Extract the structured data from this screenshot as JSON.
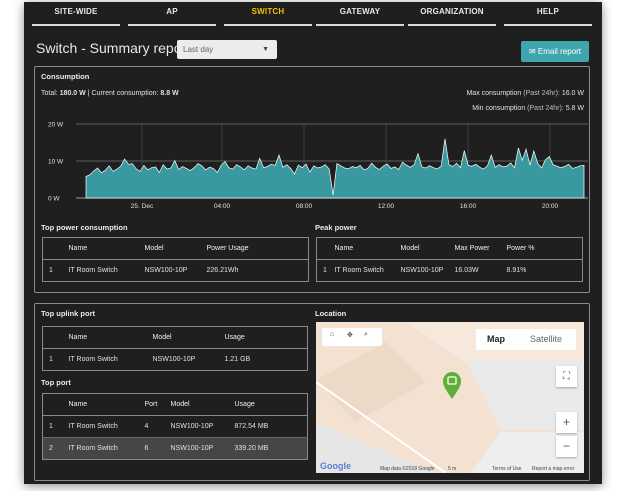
{
  "nav": [
    {
      "label": "SITE-WIDE",
      "active": false
    },
    {
      "label": "AP",
      "active": false
    },
    {
      "label": "SWITCH",
      "active": true
    },
    {
      "label": "GATEWAY",
      "active": false
    },
    {
      "label": "ORGANIZATION",
      "active": false
    },
    {
      "label": "HELP",
      "active": false
    }
  ],
  "header": {
    "title": "Switch - Summary report",
    "period": "Last day",
    "email_label": "Email report"
  },
  "consumption": {
    "title": "Consumption",
    "total_label": "Total:",
    "total": "180.0 W",
    "sep": "|",
    "current_label": "Current consumption:",
    "current": "8.8 W",
    "max_label": "Max consumption",
    "max_range": "(Past 24hr):",
    "max": "16.0 W",
    "min_label": "Min consumption",
    "min_range": "(Past 24hr):",
    "min": "5.8 W"
  },
  "chart_data": {
    "type": "area",
    "yticks": [
      "20 W",
      "10 W",
      "0 W"
    ],
    "ylim": [
      0,
      20
    ],
    "xticks": [
      "25. Dec",
      "04:00",
      "08:00",
      "12:00",
      "16:00",
      "20:00"
    ],
    "color": "#3a98a0",
    "values": [
      5.8,
      6.3,
      7.3,
      8.1,
      6.8,
      7.5,
      8.7,
      7.2,
      7.8,
      8.6,
      10.5,
      9.1,
      9.3,
      7.9,
      7.2,
      8.8,
      7.6,
      8.2,
      8.4,
      6.9,
      9.0,
      7.8,
      8.1,
      10.1,
      7.7,
      8.5,
      8.0,
      7.4,
      8.2,
      9.3,
      8.7,
      7.6,
      8.3,
      8.0,
      6.9,
      8.8,
      9.9,
      8.2,
      7.8,
      9.0,
      8.4,
      7.6,
      8.7,
      8.1,
      7.8,
      10.7,
      8.2,
      8.5,
      9.1,
      8.8,
      11.6,
      8.3,
      9.0,
      8.0,
      6.5,
      8.9,
      8.2,
      9.2,
      7.0,
      8.7,
      8.1,
      8.4,
      9.0,
      7.8,
      0.8,
      9.3,
      8.7,
      8.1,
      7.9,
      8.5,
      8.2,
      8.8,
      7.6,
      8.0,
      9.4,
      8.3,
      7.7,
      8.6,
      9.2,
      8.0,
      8.4,
      7.7,
      9.7,
      8.9,
      8.3,
      9.0,
      12.0,
      8.4,
      8.1,
      8.7,
      8.2,
      7.9,
      8.6,
      16.0,
      9.0,
      8.5,
      9.4,
      8.2,
      12.8,
      8.8,
      8.6,
      9.1,
      8.3,
      7.8,
      8.7,
      11.6,
      8.3,
      9.0,
      8.4,
      8.6,
      9.5,
      8.2,
      13.5,
      10.2,
      13.2,
      8.9,
      12.7,
      9.4,
      8.1,
      10.3,
      11.2,
      9.0,
      8.6,
      8.2,
      8.5,
      9.1,
      8.0,
      8.3,
      8.7,
      8.8
    ],
    "dip_index": 64
  },
  "top_power": {
    "title": "Top power consumption",
    "headers": [
      "Name",
      "Model",
      "Power Usage"
    ],
    "rows": [
      {
        "rank": "1",
        "name": "IT Room Switch",
        "model": "NSW100-10P",
        "usage": "226.21Wh"
      }
    ]
  },
  "peak_power": {
    "title": "Peak power",
    "headers": [
      "Name",
      "Model",
      "Max Power",
      "Power %"
    ],
    "rows": [
      {
        "rank": "1",
        "name": "IT Room Switch",
        "model": "NSW100-10P",
        "max": "16.03W",
        "pct": "8.91%"
      }
    ]
  },
  "top_uplink": {
    "title": "Top uplink port",
    "headers": [
      "Name",
      "Model",
      "Usage"
    ],
    "rows": [
      {
        "rank": "1",
        "name": "IT Room Switch",
        "model": "NSW100-10P",
        "usage": "1.21 GB"
      }
    ]
  },
  "top_port": {
    "title": "Top port",
    "headers": [
      "Name",
      "Port",
      "Model",
      "Usage"
    ],
    "rows": [
      {
        "rank": "1",
        "name": "IT Room Switch",
        "port": "4",
        "model": "NSW100-10P",
        "usage": "872.54 MB"
      },
      {
        "rank": "2",
        "name": "IT Room Switch",
        "port": "6",
        "model": "NSW100-10P",
        "usage": "339.20 MB"
      }
    ]
  },
  "location": {
    "title": "Location",
    "map_label": "Map",
    "satellite_label": "Satellite",
    "zoom_in": "+",
    "zoom_out": "−",
    "fullscreen": "⛶",
    "toolbar": {
      "home": "⌂",
      "move": "✥",
      "search": "⌕"
    },
    "google_logo": "Google",
    "attribution": "Map data ©2018 Google",
    "scale": "5 m",
    "terms": "Terms of Use",
    "report": "Report a map error",
    "icons": {
      "pin": "map-pin-icon",
      "home": "home-icon",
      "move": "move-icon",
      "search": "search-icon",
      "fullscreen": "fullscreen-icon",
      "zoom_in": "zoom-in-icon",
      "zoom_out": "zoom-out-icon"
    }
  },
  "colors": {
    "background": "#1f1f1f",
    "accent": "#3fa6ad",
    "active_nav": "#f2c200",
    "link": "#35b0b8",
    "pin": "#5cb037",
    "area": "#3a98a0"
  }
}
